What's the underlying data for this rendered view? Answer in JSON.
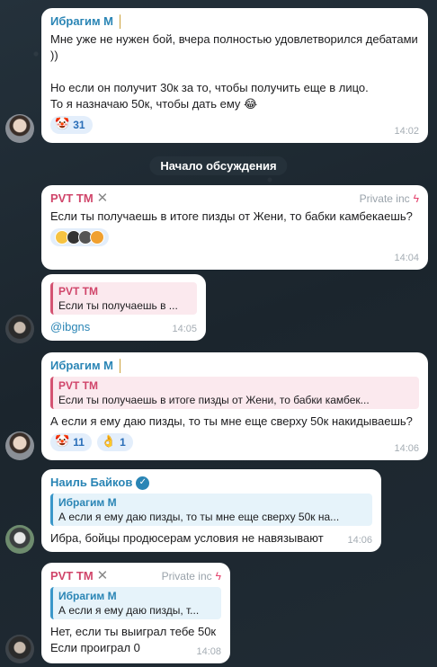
{
  "divider": "Начало обсуждения",
  "messages": {
    "m1": {
      "sender": "Ибрагим М",
      "text": "Мне уже не нужен бой, вчера полностью удовлетворился дебатами ))\n\nНо если он получит 30к за то, чтобы получить еще в лицо.\nТо я назначаю 50к, чтобы дать ему 😂",
      "reaction_count": "31",
      "time": "14:02"
    },
    "m2": {
      "sender": "PVT TM",
      "tag": "Private inc",
      "text": "Если ты получаешь в итоге пизды от Жени, то бабки камбекаешь?",
      "time": "14:04"
    },
    "m3": {
      "reply_name": "PVT TM",
      "reply_text": "Если ты получаешь в ...",
      "text": "@ibgns",
      "time": "14:05"
    },
    "m4": {
      "sender": "Ибрагим М",
      "reply_name": "PVT TM",
      "reply_text": "Если ты получаешь в итоге пизды от Жени, то бабки камбек...",
      "text": "А если я ему даю пизды, то ты мне еще сверху 50к накидываешь?",
      "reaction1_count": "11",
      "reaction2_count": "1",
      "time": "14:06"
    },
    "m5": {
      "sender": "Наиль Байков",
      "reply_name": "Ибрагим М",
      "reply_text": "А если я ему даю пизды, то ты мне еще сверху 50к на...",
      "text": "Ибра, бойцы продюсерам условия не навязывают",
      "time": "14:06"
    },
    "m6": {
      "sender": "PVT TM",
      "tag": "Private inc",
      "reply_name": "Ибрагим М",
      "reply_text": "А если я ему даю пизды, т...",
      "text": "Нет, если ты выиграл тебе 50к\nЕсли проиграл 0",
      "time": "14:08"
    }
  },
  "icons": {
    "tie": "necktie-icon",
    "lightning": "lightning-icon",
    "verified": "verified-badge-icon",
    "cross": "cross-logo-icon"
  },
  "colors": {
    "accent_blue": "#2a85b5",
    "accent_pink": "#d0456a",
    "bubble": "#ffffff"
  }
}
